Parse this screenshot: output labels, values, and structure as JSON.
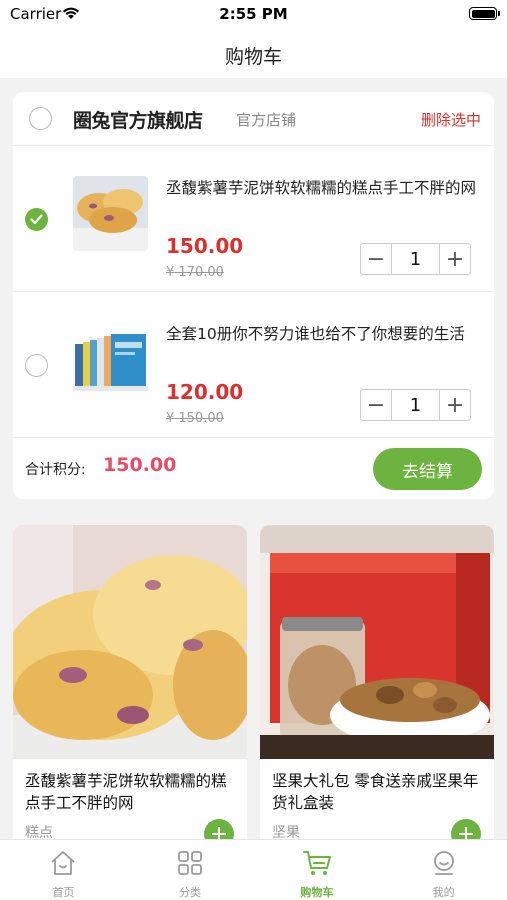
{
  "status": {
    "carrier": "Carrier",
    "time": "2:55 PM"
  },
  "nav": {
    "title": "购物车"
  },
  "shop": {
    "name": "圈兔官方旗舰店",
    "tag": "官方店铺",
    "delete_label": "删除选中"
  },
  "cart_items": [
    {
      "title": "丞馥紫薯芋泥饼软软糯糯的糕点手工不胖的网",
      "price": "150.00",
      "original_price": "¥ 170.00",
      "quantity": "1",
      "checked": true
    },
    {
      "title": "全套10册你不努力谁也给不了你想要的生活",
      "price": "120.00",
      "original_price": "¥ 150.00",
      "quantity": "1",
      "checked": false
    }
  ],
  "stepper": {
    "minus": "−",
    "plus": "+"
  },
  "total": {
    "label": "合计积分:",
    "value": "150.00",
    "checkout_label": "去结算"
  },
  "recommendations": [
    {
      "title": "丞馥紫薯芋泥饼软软糯糯的糕点手工不胖的网",
      "category": "糕点"
    },
    {
      "title": "坚果大礼包 零食送亲戚坚果年货礼盒装",
      "category": "坚果"
    }
  ],
  "tabs": [
    {
      "label": "首页",
      "icon": "home-icon",
      "active": false
    },
    {
      "label": "分类",
      "icon": "grid-icon",
      "active": false
    },
    {
      "label": "购物车",
      "icon": "cart-icon",
      "active": true
    },
    {
      "label": "我的",
      "icon": "profile-icon",
      "active": false
    }
  ],
  "colors": {
    "accent": "#6cb33f",
    "price": "#d9312f",
    "total": "#e54d67",
    "delete": "#d9312f"
  }
}
